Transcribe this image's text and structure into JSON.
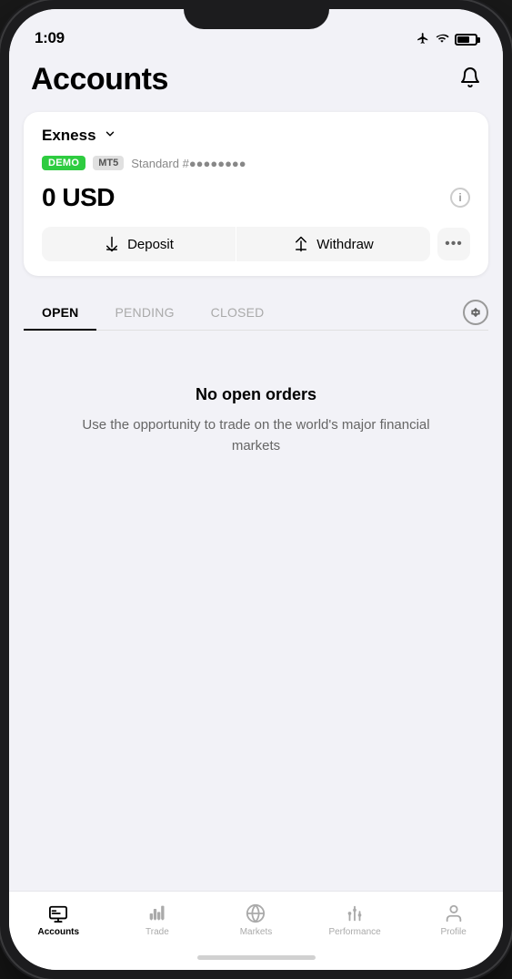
{
  "statusBar": {
    "time": "1:09",
    "icons": [
      "airplane",
      "wifi",
      "battery"
    ]
  },
  "header": {
    "title": "Accounts",
    "notificationIcon": "bell"
  },
  "accountCard": {
    "brokerName": "Exness",
    "badgeDemo": "DEMO",
    "badgePlatform": "MT5",
    "accountType": "Standard #",
    "accountNumber": "●●●●●●●●",
    "balance": "0 USD",
    "infoIcon": "i",
    "depositLabel": "Deposit",
    "withdrawLabel": "Withdraw",
    "moreLabel": "•••"
  },
  "orderTabs": {
    "tabs": [
      {
        "id": "open",
        "label": "OPEN",
        "active": true
      },
      {
        "id": "pending",
        "label": "PENDING",
        "active": false
      },
      {
        "id": "closed",
        "label": "CLOSED",
        "active": false
      }
    ],
    "sortIcon": "sort"
  },
  "emptyState": {
    "title": "No open orders",
    "subtitle": "Use the opportunity to trade on the world's major financial markets"
  },
  "bottomNav": {
    "items": [
      {
        "id": "accounts",
        "label": "Accounts",
        "active": true,
        "icon": "accounts"
      },
      {
        "id": "trade",
        "label": "Trade",
        "active": false,
        "icon": "trade"
      },
      {
        "id": "markets",
        "label": "Markets",
        "active": false,
        "icon": "markets"
      },
      {
        "id": "performance",
        "label": "Performance",
        "active": false,
        "icon": "performance"
      },
      {
        "id": "profile",
        "label": "Profile",
        "active": false,
        "icon": "profile"
      }
    ]
  }
}
